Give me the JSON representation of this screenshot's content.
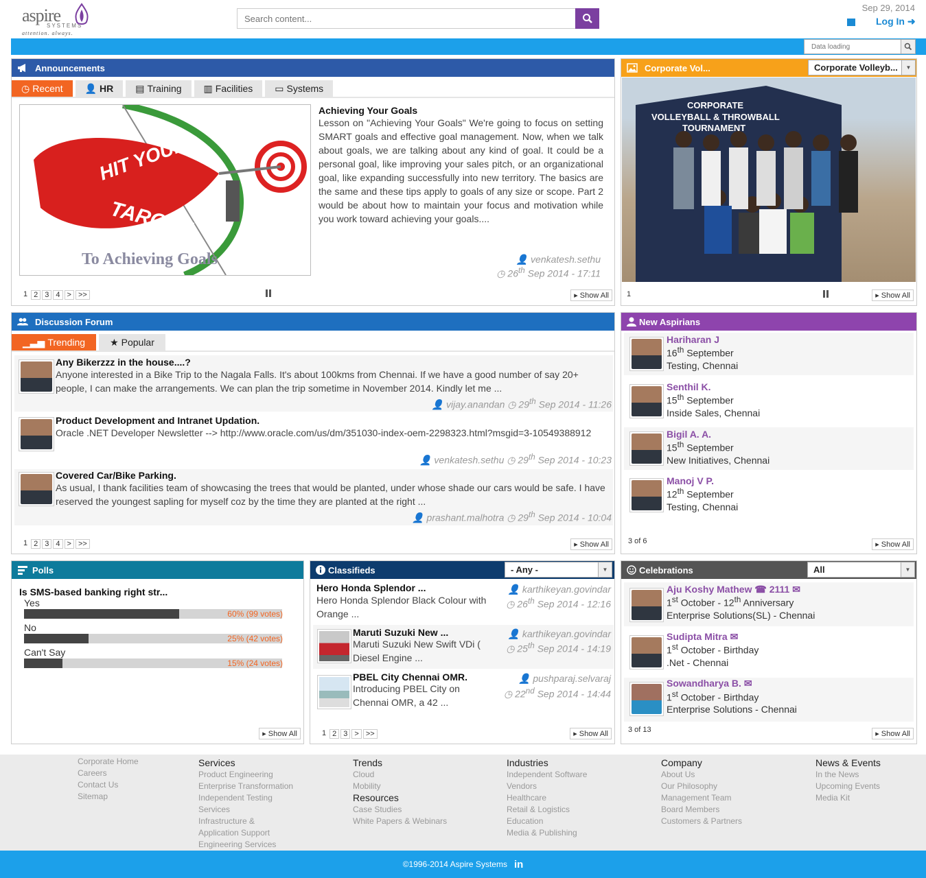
{
  "header": {
    "logo_word": "aspire",
    "logo_systems": "SYSTEMS",
    "logo_tagline": "attention. always.",
    "search_placeholder": "Search content...",
    "date": "Sep 29, 2014",
    "login": "Log In"
  },
  "toolbar": {
    "data_loading_placeholder": "Data loading"
  },
  "announcements": {
    "title": "Announcements",
    "tabs": [
      "Recent",
      "HR",
      "Training",
      "Facilities",
      "Systems"
    ],
    "image_text_line1": "HIT YOUR",
    "image_text_line2": "TARGET",
    "image_caption": "To Achieving Goals",
    "article_title": "Achieving Your Goals",
    "article_body": "Lesson on \"Achieving Your Goals\" We're going to focus on setting SMART goals and effective goal management. Now, when we talk about goals, we are talking about any kind of goal. It could be a personal goal, like improving your sales pitch, or an organizational goal, like expanding successfully into new territory. The basics are the same and these tips apply to goals of any size or scope. Part 2 would be about how to maintain your focus and motivation while you work toward achieving your goals....",
    "author": "venkatesh.sethu",
    "date_day": "26",
    "date_sup": "th",
    "date_rest": " Sep 2014 - 17:11",
    "pages": [
      "1",
      "2",
      "3",
      "4",
      ">",
      ">>"
    ],
    "show_all": "Show All"
  },
  "corporate": {
    "title": "Corporate Vol...",
    "dropdown": "Corporate Volleyb...",
    "banner_line1": "CORPORATE",
    "banner_line2": "VOLLEYBALL & THROWBALL",
    "banner_line3": "TOURNAMENT",
    "page": "1",
    "show_all": "Show All"
  },
  "forum": {
    "title": "Discussion Forum",
    "tabs": [
      "Trending",
      "Popular"
    ],
    "items": [
      {
        "title": "Any Bikerzzz in the house....?",
        "body": "Anyone interested in a Bike Trip to the Nagala Falls. It's about 100kms from Chennai. If we have a good number of say 20+ people, I can make the arrangements. We can plan the trip sometime in November 2014. Kindly let me ...",
        "author": "vijay.anandan",
        "day": "29",
        "sup": "th",
        "rest": " Sep 2014 - 11:26"
      },
      {
        "title": "Product Development and Intranet Updation.",
        "body": "Oracle .NET Developer Newsletter --> http://www.oracle.com/us/dm/351030-index-oem-2298323.html?msgid=3-10549388912",
        "author": "venkatesh.sethu",
        "day": "29",
        "sup": "th",
        "rest": " Sep 2014 - 10:23"
      },
      {
        "title": "Covered Car/Bike Parking.",
        "body": "As usual, I thank facilities team of showcasing the trees that would be planted, under whose shade our cars would be safe. I have reserved the youngest sapling for myself coz by the time they are planted at the right ...",
        "author": "prashant.malhotra",
        "day": "29",
        "sup": "th",
        "rest": " Sep 2014 - 10:04"
      }
    ],
    "pages": [
      "1",
      "2",
      "3",
      "4",
      ">",
      ">>"
    ],
    "show_all": "Show All"
  },
  "aspirians": {
    "title": "New Aspirians",
    "items": [
      {
        "name": "Hariharan J",
        "day": "16",
        "sup": "th",
        "rest": " September",
        "dept": "Testing, Chennai"
      },
      {
        "name": "Senthil K.",
        "day": "15",
        "sup": "th",
        "rest": " September",
        "dept": "Inside Sales, Chennai"
      },
      {
        "name": "Bigil A. A.",
        "day": "15",
        "sup": "th",
        "rest": " September",
        "dept": "New Initiatives, Chennai"
      },
      {
        "name": "Manoj V P.",
        "day": "12",
        "sup": "th",
        "rest": " September",
        "dept": "Testing, Chennai"
      }
    ],
    "count": "3 of 6",
    "show_all": "Show All"
  },
  "polls": {
    "title": "Polls",
    "question": "Is SMS-based banking right str...",
    "options": [
      {
        "label": "Yes",
        "pct": 60,
        "text": "60% (99 votes)"
      },
      {
        "label": "No",
        "pct": 25,
        "text": "25% (42 votes)"
      },
      {
        "label": "Can't Say",
        "pct": 15,
        "text": "15% (24 votes)"
      }
    ],
    "show_all": "Show All"
  },
  "classifieds": {
    "title": "Classifieds",
    "dropdown": "- Any -",
    "items": [
      {
        "title": "Hero Honda Splendor ...",
        "body": "Hero Honda Splendor Black Colour with Orange ...",
        "author": "karthikeyan.govindar",
        "day": "26",
        "sup": "th",
        "rest": " Sep 2014 - 12:16"
      },
      {
        "title": "Maruti Suzuki New ...",
        "body": "Maruti Suzuki New Swift VDi ( Diesel Engine ...",
        "author": "karthikeyan.govindar",
        "day": "25",
        "sup": "th",
        "rest": " Sep 2014 - 14:19"
      },
      {
        "title": "PBEL City Chennai OMR.",
        "body": "Introducing PBEL City on Chennai OMR, a 42 ...",
        "author": "pushparaj.selvaraj",
        "day": "22",
        "sup": "nd",
        "rest": " Sep 2014 - 14:44"
      }
    ],
    "pages": [
      "1",
      "2",
      "3",
      ">",
      ">>"
    ],
    "show_all": "Show All"
  },
  "celebrations": {
    "title": "Celebrations",
    "dropdown": "All",
    "items": [
      {
        "name": "Aju Koshy Mathew",
        "ext": "2111",
        "d1": "1",
        "s1": "st",
        "mid": " October - ",
        "d2": "12",
        "s2": "th",
        "end": " Anniversary",
        "dept": "Enterprise Solutions(SL) - Chennai"
      },
      {
        "name": "Sudipta Mitra",
        "ext": "",
        "d1": "1",
        "s1": "st",
        "mid": " October - Birthday",
        "d2": "",
        "s2": "",
        "end": "",
        "dept": ".Net - Chennai"
      },
      {
        "name": "Sowandharya B.",
        "ext": "",
        "d1": "1",
        "s1": "st",
        "mid": " October - Birthday",
        "d2": "",
        "s2": "",
        "end": "",
        "dept": "Enterprise Solutions - Chennai"
      }
    ],
    "count": "3 of 13",
    "show_all": "Show All"
  },
  "footer": {
    "col1": {
      "heading": "",
      "links": [
        "Corporate Home",
        "Careers",
        "Contact Us",
        "Sitemap"
      ]
    },
    "col2": {
      "heading": "Services",
      "links": [
        "Product Engineering",
        "Enterprise Transformation",
        "Independent Testing",
        "Services",
        "Infrastructure &",
        "Application Support",
        "Engineering Services"
      ]
    },
    "col3": {
      "heading": "Trends",
      "links": [
        "Cloud",
        "Mobility"
      ],
      "heading2": "Resources",
      "links2": [
        "Case Studies",
        "White Papers & Webinars"
      ]
    },
    "col4": {
      "heading": "Industries",
      "links": [
        "Independent Software",
        "Vendors",
        "Healthcare",
        "Retail & Logistics",
        "Education",
        "Media & Publishing"
      ]
    },
    "col5": {
      "heading": "Company",
      "links": [
        "About Us",
        "Our Philosophy",
        "Management Team",
        "Board Members",
        "Customers & Partners"
      ]
    },
    "col6": {
      "heading": "News & Events",
      "links": [
        "In the News",
        "Upcoming Events",
        "Media Kit"
      ]
    },
    "copyright": "©1996-2014 Aspire Systems",
    "linkedin": "in"
  },
  "colors": {
    "announce": "#2d5aa8",
    "corporate": "#f7a11a",
    "forum": "#1e6fbf",
    "aspirians": "#8e44ad",
    "polls": "#0e7b9c",
    "classifieds": "#0d3c6e",
    "celebrations": "#555555",
    "accent": "#1ca0ea",
    "orange": "#f26522"
  }
}
